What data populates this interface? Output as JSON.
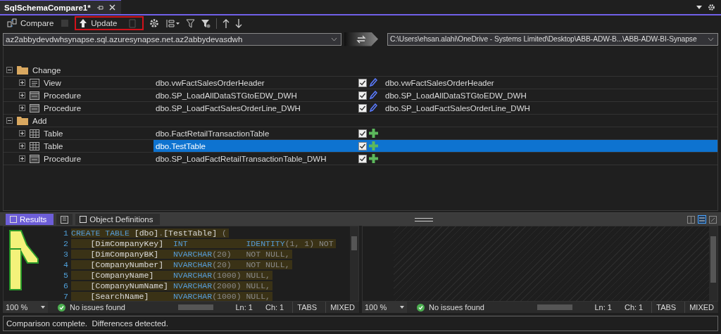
{
  "document_tab": {
    "title": "SqlSchemaCompare1*"
  },
  "toolbar": {
    "compare_label": "Compare",
    "update_label": "Update",
    "update_annotated": true
  },
  "source": {
    "value": "az2abbydevdwhsynapse.sql.azuresynapse.net.az2abbydevasdwh"
  },
  "target": {
    "value": "C:\\Users\\ehsan.alahi\\OneDrive - Systems Limited\\Desktop\\ABB-ADW-B...\\ABB-ADW-BI-Synapse"
  },
  "groups": [
    {
      "name": "Change",
      "kind": "change",
      "expanded": true,
      "items": [
        {
          "kind": "view",
          "type": "View",
          "source_name": "dbo.vwFactSalesOrderHeader",
          "checked": true,
          "target_name": "dbo.vwFactSalesOrderHeader",
          "selected": false
        },
        {
          "kind": "procedure",
          "type": "Procedure",
          "source_name": "dbo.SP_LoadAllDataSTGtoEDW_DWH",
          "checked": true,
          "target_name": "dbo.SP_LoadAllDataSTGtoEDW_DWH",
          "selected": false
        },
        {
          "kind": "procedure",
          "type": "Procedure",
          "source_name": "dbo.SP_LoadFactSalesOrderLine_DWH",
          "checked": true,
          "target_name": "dbo.SP_LoadFactSalesOrderLine_DWH",
          "selected": false
        }
      ]
    },
    {
      "name": "Add",
      "kind": "add",
      "expanded": true,
      "items": [
        {
          "kind": "table",
          "type": "Table",
          "source_name": "dbo.FactRetailTransactionTable",
          "checked": true,
          "selected": false
        },
        {
          "kind": "table",
          "type": "Table",
          "source_name": "dbo.TestTable",
          "checked": true,
          "selected": true
        },
        {
          "kind": "procedure",
          "type": "Procedure",
          "source_name": "dbo.SP_LoadFactRetailTransactionTable_DWH",
          "checked": true,
          "selected": false
        }
      ]
    }
  ],
  "bottom_tabs": [
    {
      "kind": "text",
      "label": "Results",
      "selected": true
    },
    {
      "kind": "icon",
      "selected": false
    },
    {
      "kind": "text",
      "label": "Object Definitions",
      "selected": false
    }
  ],
  "code_lines": [
    {
      "kind": "statement",
      "number": "1",
      "keyword": "CREATE TABLE",
      "schema": "[dbo]",
      "dot": ".",
      "table": "[TestTable]",
      "open": "("
    },
    {
      "kind": "column",
      "number": "2",
      "name": "[DimCompanyKey]",
      "type": "INT",
      "keyword": "IDENTITY",
      "rest": "(1, 1) NOT"
    },
    {
      "kind": "column",
      "number": "3",
      "name": "[DimCompanyBK]",
      "type": "NVARCHAR",
      "size": "(20)",
      "rest": "NOT NULL,"
    },
    {
      "kind": "column",
      "number": "4",
      "name": "[CompanyNumber]",
      "type": "NVARCHAR",
      "size": "(20)",
      "rest": "NOT NULL,"
    },
    {
      "kind": "column",
      "number": "5",
      "name": "[CompanyName]",
      "type": "NVARCHAR",
      "size": "(1000)",
      "rest": "NULL,"
    },
    {
      "kind": "column",
      "number": "6",
      "name": "[CompanyNumName]",
      "type": "NVARCHAR",
      "size": "(2000)",
      "rest": "NULL,"
    },
    {
      "kind": "column",
      "number": "7",
      "name": "[SearchName]",
      "type": "NVARCHAR",
      "size": "(1000)",
      "rest": "NULL,"
    }
  ],
  "editor_status": [
    {
      "zoom": "100 %",
      "issues": "No issues found",
      "line": "Ln: 1",
      "column": "Ch: 1",
      "indent": "TABS",
      "line_endings": "MIXED"
    },
    {
      "zoom": "100 %",
      "issues": "No issues found",
      "line": "Ln: 1",
      "column": "Ch: 1",
      "indent": "TABS",
      "line_endings": "MIXED"
    }
  ],
  "status_message": "Comparison complete.  Differences detected."
}
